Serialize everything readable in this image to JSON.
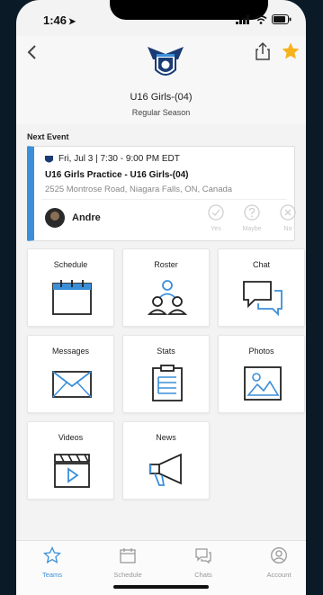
{
  "status": {
    "time": "1:46",
    "location_glyph": "➤"
  },
  "header": {
    "team_name": "U16 Girls-(04)",
    "season": "Regular Season",
    "accent": "#3b8fd9",
    "star_color": "#f6b21b"
  },
  "next_event": {
    "section_label": "Next Event",
    "date_time": "Fri, Jul 3 | 7:30 - 9:00 PM EDT",
    "title": "U16 Girls Practice - U16 Girls-(04)",
    "address": "2525 Montrose Road, Niagara Falls, ON, Canada",
    "user": "Andre",
    "rsvp": [
      {
        "label": "Yes",
        "icon": "check-circle-icon"
      },
      {
        "label": "Maybe",
        "icon": "question-circle-icon"
      },
      {
        "label": "No",
        "icon": "x-circle-icon"
      }
    ]
  },
  "tiles": [
    {
      "label": "Schedule",
      "icon": "calendar-icon"
    },
    {
      "label": "Roster",
      "icon": "people-icon"
    },
    {
      "label": "Chat",
      "icon": "chat-bubbles-icon"
    },
    {
      "label": "Messages",
      "icon": "envelope-icon"
    },
    {
      "label": "Stats",
      "icon": "clipboard-icon"
    },
    {
      "label": "Photos",
      "icon": "image-icon"
    },
    {
      "label": "Videos",
      "icon": "clapperboard-icon"
    },
    {
      "label": "News",
      "icon": "megaphone-icon"
    }
  ],
  "tabbar": [
    {
      "label": "Teams",
      "icon": "star-outline-icon",
      "active": true
    },
    {
      "label": "Schedule",
      "icon": "calendar-icon",
      "active": false
    },
    {
      "label": "Chats",
      "icon": "chat-icon",
      "active": false
    },
    {
      "label": "Account",
      "icon": "user-circle-icon",
      "active": false
    }
  ]
}
